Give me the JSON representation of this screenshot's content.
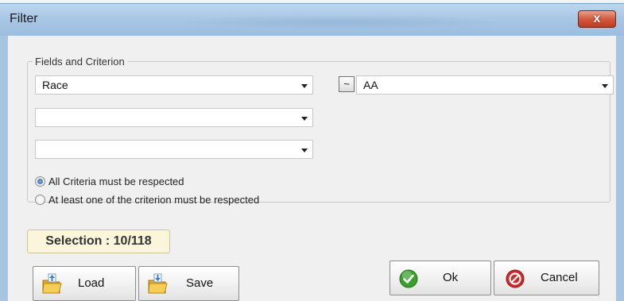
{
  "window": {
    "title": "Filter",
    "close_glyph": "x"
  },
  "fields_group": {
    "legend": "Fields and Criterion",
    "field_1": {
      "value": "Race"
    },
    "field_2": {
      "value": ""
    },
    "field_3": {
      "value": ""
    },
    "criterion_button_glyph": "~",
    "criterion_1": {
      "value": "AA"
    }
  },
  "options": {
    "all_label": "All Criteria must be respected",
    "any_label": "At least one of the criterion must be respected",
    "selected": "all"
  },
  "selection": {
    "text": "Selection : 10/118"
  },
  "buttons": {
    "load_label": "Load",
    "save_label": "Save",
    "ok_label": "Ok",
    "cancel_label": "Cancel"
  },
  "icons": {
    "load": "folder-open-icon",
    "save": "folder-save-icon",
    "ok": "check-circle-icon",
    "cancel": "forbidden-circle-icon"
  },
  "colors": {
    "titlebar": "#a9c7e5",
    "close_button": "#c03a20",
    "dialog_bg": "#f0f0f0",
    "selection_bg": "#fbf5dc",
    "ok_green": "#3aa02c",
    "cancel_red": "#d02a2a"
  }
}
